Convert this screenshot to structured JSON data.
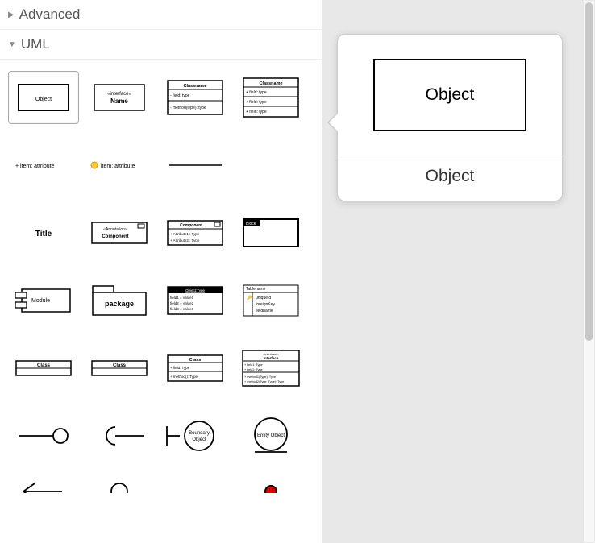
{
  "categories": {
    "advanced": {
      "label": "Advanced",
      "collapsed": true
    },
    "uml": {
      "label": "UML",
      "collapsed": false
    }
  },
  "shapes": [
    {
      "id": "object",
      "label": "Object"
    },
    {
      "id": "interface",
      "stereotype": "«interface»",
      "name": "Name"
    },
    {
      "id": "class2",
      "title": "Classname",
      "field": "- field: type",
      "method": "- method(type): type"
    },
    {
      "id": "class3",
      "title": "Classname",
      "f1": "+ field: type",
      "f2": "+ field: type",
      "f3": "+ field: type"
    },
    {
      "id": "attribute",
      "label": "+ item: attribute"
    },
    {
      "id": "attribute-icon",
      "label": "item: attribute"
    },
    {
      "id": "divider"
    },
    {
      "id": "blank"
    },
    {
      "id": "title",
      "label": "Title"
    },
    {
      "id": "annotation",
      "stereotype": "«Annotation»",
      "name": "Component"
    },
    {
      "id": "component",
      "title": "Component",
      "a1": "+ Attribute1 : Type",
      "a2": "+ Attribute2 : Type"
    },
    {
      "id": "block",
      "title": "Block"
    },
    {
      "id": "module",
      "label": "Module"
    },
    {
      "id": "package",
      "label": "package"
    },
    {
      "id": "object-type",
      "title": "Object:Type",
      "f1": "field1 = value1",
      "f2": "field2 = value2",
      "f3": "field3 = value3"
    },
    {
      "id": "tablename",
      "title": "Tablename",
      "f1": "uniqueId",
      "f2": "foreignKey",
      "f3": "fieldname"
    },
    {
      "id": "class-simple",
      "title": "Class"
    },
    {
      "id": "class-tr",
      "title": "Class"
    },
    {
      "id": "class-fm",
      "title": "Class",
      "f1": "+ field: Type",
      "m1": "+ method(): Type"
    },
    {
      "id": "interface-full",
      "stereotype": "«interface»",
      "name": "Interface",
      "f1": "+ field1: Type",
      "f2": "+ field2: Type",
      "m1": "+ method1(Type): Type",
      "m2": "+ method2(Type, Type): Type"
    },
    {
      "id": "lollipop"
    },
    {
      "id": "socket"
    },
    {
      "id": "boundary",
      "label": "Boundary Object"
    },
    {
      "id": "entity",
      "label": "Entity Object"
    },
    {
      "id": "arrow-open"
    },
    {
      "id": "circle2"
    },
    {
      "id": "spacer2"
    },
    {
      "id": "red-dot"
    }
  ],
  "preview": {
    "shape_text": "Object",
    "label": "Object"
  }
}
